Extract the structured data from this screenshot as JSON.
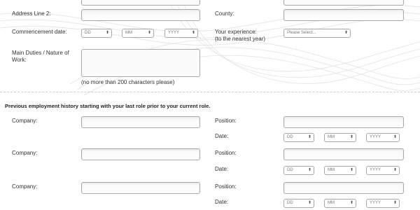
{
  "current_role": {
    "address_line_2_label": "Address Line 2:",
    "county_label": "County:",
    "commencement_label": "Commencement date:",
    "commencement_dd": "DD",
    "commencement_mm": "MM",
    "commencement_yyyy": "YYYY",
    "experience_label_1": "Your experience:",
    "experience_label_2": "(to the nearest year)",
    "experience_select": "Please Select...",
    "duties_label_1": "Main Duties / Nature of",
    "duties_label_2": "Work:",
    "duties_note": "(no more than 200 characters please)"
  },
  "previous": {
    "heading": "Previous employment history starting with your last role prior to your current role.",
    "entries": [
      {
        "company_label": "Company:",
        "position_label": "Position:",
        "date_label": "Date:",
        "dd": "DD",
        "mm": "MM",
        "yyyy": "YYYY"
      },
      {
        "company_label": "Company:",
        "position_label": "Position:",
        "date_label": "Date:",
        "dd": "DD",
        "mm": "MM",
        "yyyy": "YYYY"
      },
      {
        "company_label": "Company:",
        "position_label": "Position:",
        "date_label": "Date:",
        "dd": "DD",
        "mm": "MM",
        "yyyy": "YYYY"
      }
    ]
  }
}
